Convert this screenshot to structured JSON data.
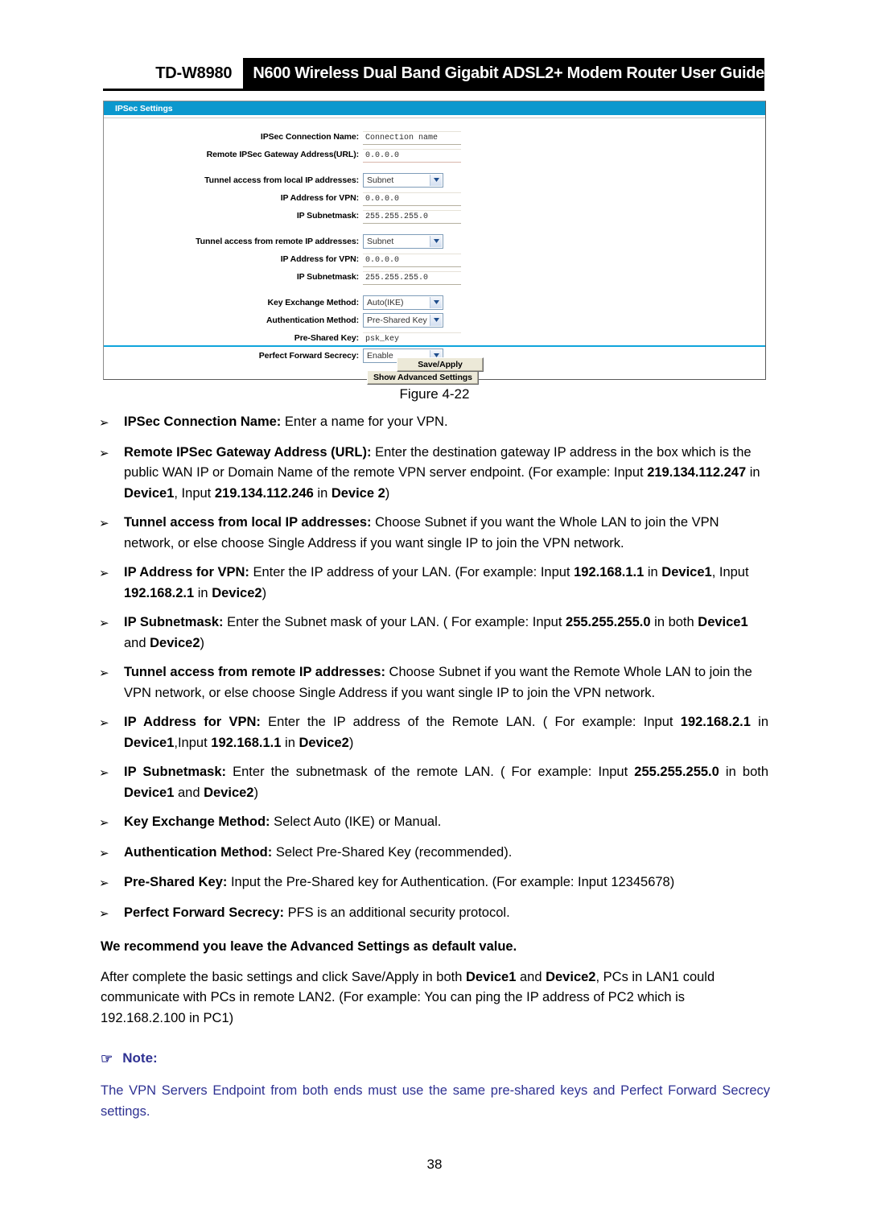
{
  "header": {
    "model": "TD-W8980",
    "title": "N600 Wireless Dual Band Gigabit ADSL2+ Modem Router User Guide"
  },
  "panel": {
    "title": "IPSec Settings",
    "rows": [
      {
        "label": "IPSec Connection Name:",
        "type": "text",
        "value": "Connection name"
      },
      {
        "label": "Remote IPSec Gateway Address(URL):",
        "type": "text",
        "value": "0.0.0.0"
      },
      {
        "label": "Tunnel access from local IP addresses:",
        "type": "select",
        "value": "Subnet"
      },
      {
        "label": "IP Address for VPN:",
        "type": "text",
        "value": "0.0.0.0"
      },
      {
        "label": "IP Subnetmask:",
        "type": "text",
        "value": "255.255.255.0"
      },
      {
        "label": "Tunnel access from remote IP addresses:",
        "type": "select",
        "value": "Subnet"
      },
      {
        "label": "IP Address for VPN:",
        "type": "text",
        "value": "0.0.0.0"
      },
      {
        "label": "IP Subnetmask:",
        "type": "text",
        "value": "255.255.255.0"
      },
      {
        "label": "Key Exchange Method:",
        "type": "select",
        "value": "Auto(IKE)"
      },
      {
        "label": "Authentication Method:",
        "type": "select",
        "value": "Pre-Shared Key"
      },
      {
        "label": "Pre-Shared Key:",
        "type": "text",
        "value": "psk_key"
      },
      {
        "label": "Perfect Forward Secrecy:",
        "type": "select",
        "value": "Enable"
      }
    ],
    "advanced_button": "Show Advanced Settings",
    "save_button": "Save/Apply"
  },
  "figure": {
    "caption": "Figure 4-22"
  },
  "note": {
    "icon": "pointing-hand-icon",
    "label": "Note:",
    "text": "The VPN Servers Endpoint from both ends must use the same pre-shared keys and Perfect Forward Secrecy settings."
  },
  "footer": {
    "page_number": "38"
  },
  "colors": {
    "panel_title_bar": "#0b98ce",
    "panel_divider": "#0fa5dc",
    "note_text": "#2e3192",
    "header_band": "#000000"
  },
  "bullet_marker": "➢"
}
